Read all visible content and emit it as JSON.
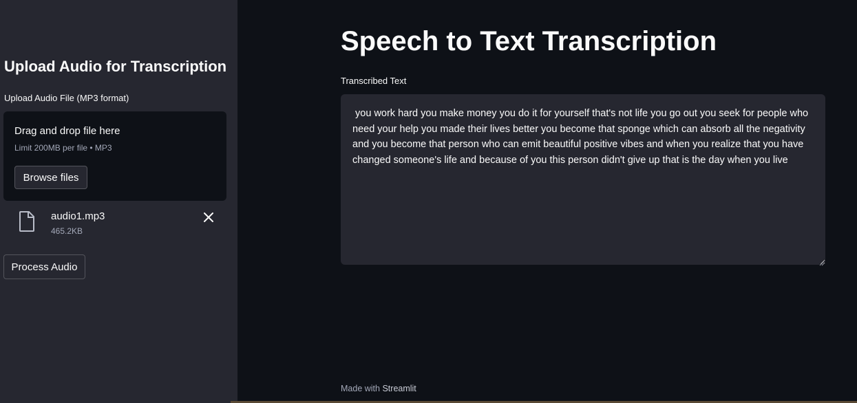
{
  "sidebar": {
    "title": "Upload Audio for Transcription",
    "upload_label": "Upload Audio File (MP3 format)",
    "dropzone": {
      "title": "Drag and drop file here",
      "limit": "Limit 200MB per file • MP3",
      "browse_label": "Browse files"
    },
    "file": {
      "icon": "file-icon",
      "name": "audio1.mp3",
      "size": "465.2KB",
      "remove_icon": "close-icon"
    },
    "process_label": "Process Audio"
  },
  "main": {
    "title": "Speech to Text Transcription",
    "textarea_label": "Transcribed Text",
    "transcription": " you work hard you make money you do it for yourself that's not life you go out you seek for people who need your help you made their lives better you become that sponge which can absorb all the negativity and you become that person who can emit beautiful positive vibes and when you realize that you have changed someone's life and because of you this person didn't give up that is the day when you live"
  },
  "footer": {
    "prefix": "Made with",
    "brand": "Streamlit"
  },
  "colors": {
    "background": "#0e1117",
    "sidebar": "#262730",
    "text": "#fafafa",
    "muted": "#a3a8b8"
  }
}
